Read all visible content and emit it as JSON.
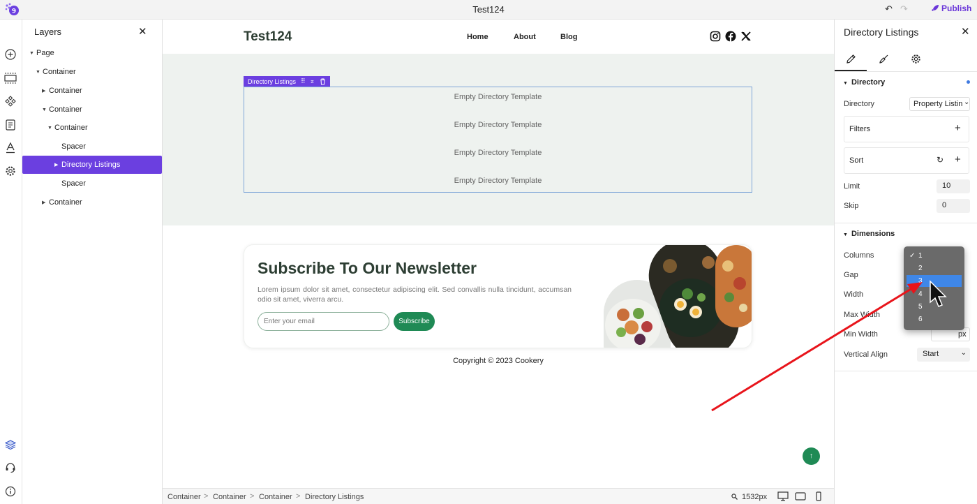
{
  "topbar": {
    "title": "Test124",
    "publish_label": "Publish",
    "logo_icon": "app-logo-icon",
    "undo_icon": "undo-icon",
    "redo_icon": "redo-icon"
  },
  "rail": {
    "icons": [
      "add-icon",
      "section-icon",
      "components-icon",
      "pages-icon",
      "typography-icon",
      "settings-icon",
      "layers-icon",
      "support-icon",
      "info-icon"
    ]
  },
  "layers": {
    "title": "Layers",
    "close_label": "✕",
    "items": [
      {
        "label": "Page",
        "caret": "▼"
      },
      {
        "label": "Container",
        "caret": "▼"
      },
      {
        "label": "Container",
        "caret": "▶"
      },
      {
        "label": "Container",
        "caret": "▼"
      },
      {
        "label": "Container",
        "caret": "▼"
      },
      {
        "label": "Spacer",
        "caret": ""
      },
      {
        "label": "Directory Listings",
        "caret": "▶"
      },
      {
        "label": "Spacer",
        "caret": ""
      },
      {
        "label": "Container",
        "caret": "▶"
      }
    ]
  },
  "site": {
    "brand": "Test124",
    "nav": [
      "Home",
      "About",
      "Blog"
    ],
    "social_icons": [
      "instagram-icon",
      "facebook-icon",
      "x-icon"
    ],
    "directory_label": "Directory Listings",
    "empty_templates": [
      "Empty Directory Template",
      "Empty Directory Template",
      "Empty Directory Template",
      "Empty Directory Template"
    ],
    "newsletter": {
      "title": "Subscribe To Our Newsletter",
      "body": "Lorem ipsum dolor sit amet, consectetur adipiscing elit. Sed convallis nulla tincidunt, accumsan odio sit amet, viverra arcu.",
      "email_placeholder": "Enter your email",
      "button": "Subscribe"
    },
    "copyright": "Copyright © 2023 Cookery",
    "scroll_top": "↑"
  },
  "statusbar": {
    "breadcrumb": [
      "Container",
      "Container",
      "Container",
      "Directory Listings"
    ],
    "separator": ">",
    "zoom": "1532px"
  },
  "props": {
    "title": "Directory Listings",
    "close_label": "✕",
    "directory_section": "Directory",
    "directory_label": "Directory",
    "directory_value": "Property Listin",
    "filters": "Filters",
    "sort": "Sort",
    "plus": "+",
    "refresh": "↻",
    "limit_label": "Limit",
    "limit_value": "10",
    "skip_label": "Skip",
    "skip_value": "0",
    "dimensions_section": "Dimensions",
    "columns_label": "Columns",
    "gap_label": "Gap",
    "width_label": "Width",
    "max_width_label": "Max Width",
    "min_width_label": "Min Width",
    "min_width_unit": "px",
    "valign_label": "Vertical Align",
    "valign_value": "Start"
  },
  "columns_dropdown": {
    "options": [
      "1",
      "2",
      "3",
      "4",
      "5",
      "6"
    ],
    "checked": "1",
    "highlighted": "3",
    "check_mark": "✓"
  },
  "colors": {
    "accent": "#6b3fe0",
    "brand_green": "#1f8a55",
    "annotation_arrow": "#e8141b"
  }
}
